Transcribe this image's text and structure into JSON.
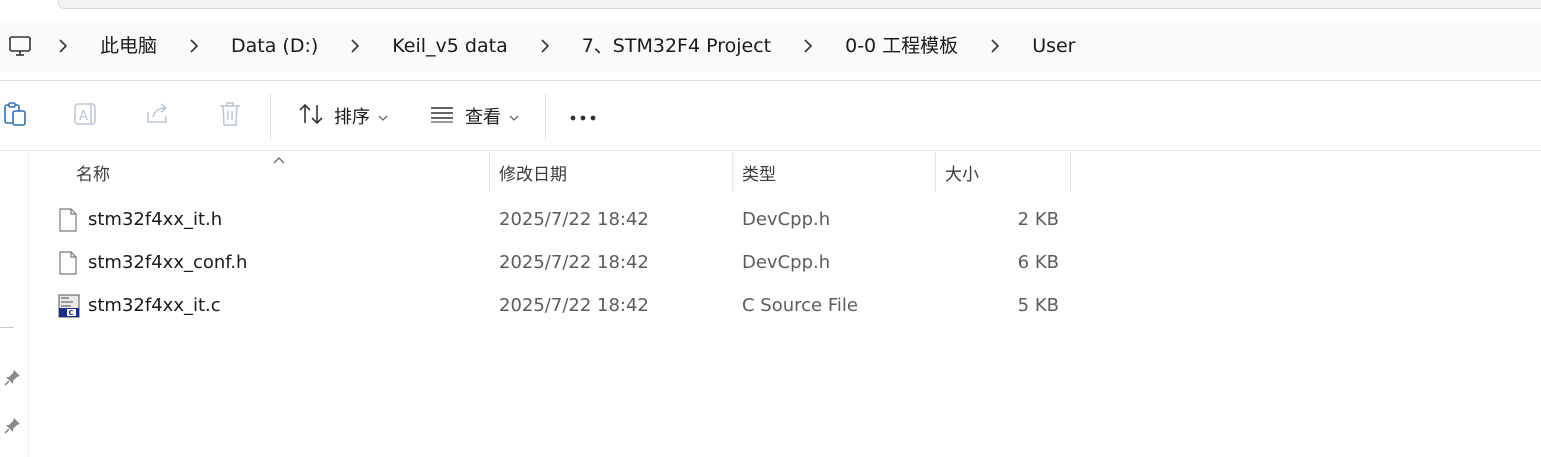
{
  "breadcrumb": {
    "items": [
      {
        "label": "此电脑"
      },
      {
        "label": "Data (D:)"
      },
      {
        "label": "Keil_v5 data"
      },
      {
        "label": "7、STM32F4 Project"
      },
      {
        "label": "0-0 工程模板"
      },
      {
        "label": "User"
      }
    ]
  },
  "toolbar": {
    "paste_icon": "clipboard-icon",
    "rename_icon": "rename-icon",
    "share_icon": "share-icon",
    "delete_icon": "trash-icon",
    "sort_label": "排序",
    "view_label": "查看",
    "more_label": "•••"
  },
  "columns": {
    "name": "名称",
    "date": "修改日期",
    "type": "类型",
    "size": "大小"
  },
  "files": [
    {
      "name": "stm32f4xx_it.h",
      "date": "2025/7/22 18:42",
      "type": "DevCpp.h",
      "size": "2 KB",
      "icon": "blank-file-icon"
    },
    {
      "name": "stm32f4xx_conf.h",
      "date": "2025/7/22 18:42",
      "type": "DevCpp.h",
      "size": "6 KB",
      "icon": "blank-file-icon"
    },
    {
      "name": "stm32f4xx_it.c",
      "date": "2025/7/22 18:42",
      "type": "C Source File",
      "size": "5 KB",
      "icon": "c-source-file-icon"
    }
  ],
  "colors": {
    "accent": "#1a1a1a",
    "muted_text": "#5c5c5c",
    "disabled_icon": "#b9c7d6"
  }
}
